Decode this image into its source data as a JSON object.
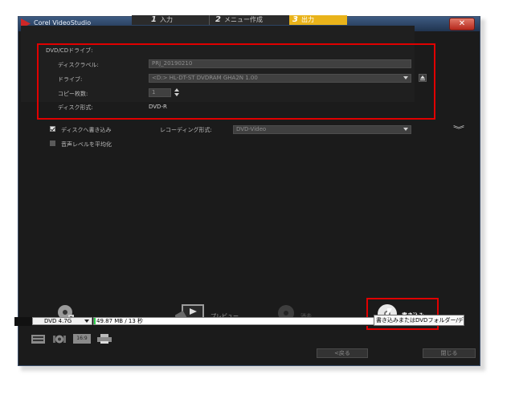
{
  "window": {
    "title": "Corel VideoStudio",
    "close_glyph": "✕"
  },
  "steps": [
    {
      "num": "1",
      "label": "入力"
    },
    {
      "num": "2",
      "label": "メニュー作成"
    },
    {
      "num": "3",
      "label": "出力"
    }
  ],
  "drive_panel": {
    "header": "DVD/CDドライブ:",
    "disc_label_label": "ディスクラベル:",
    "disc_label_value": "PRJ_20190210",
    "drive_label": "ドライブ:",
    "drive_value": "<D:>  HL-DT-ST DVDRAM GHA2N 1.00",
    "copies_label": "コピー枚数:",
    "copies_value": "1",
    "disc_format_label": "ディスク形式:",
    "disc_format_value": "DVD-R"
  },
  "options": {
    "burn_to_disc_label": "ディスクへ書き込み",
    "burn_to_disc_checked": true,
    "equalize_audio_label": "音声レベルを平均化",
    "equalize_audio_checked": false,
    "recording_format_label": "レコーディング形式:",
    "recording_format_value": "DVD-Video"
  },
  "actions": {
    "preview_label": "プレビュー",
    "erase_label": "消去",
    "burn_label": "書き込み"
  },
  "status": {
    "disc_type": "DVD 4.7G",
    "capacity_text": "49.87 MB / 13 秒",
    "capacity_fraction": 0.006,
    "tooltip": "書き込みまたはDVDフォルダー/ディスクイメージの作成"
  },
  "footer": {
    "back_label": "<戻る",
    "close_label": "閉じる",
    "tools": [
      "list-icon",
      "settings-icon",
      "aspect-16-9-icon",
      "print-icon"
    ],
    "aspect_label": "16:9"
  },
  "colors": {
    "accent": "#e9b31a",
    "highlight_box": "#e00000",
    "capacity_fill": "#2bd14a"
  }
}
